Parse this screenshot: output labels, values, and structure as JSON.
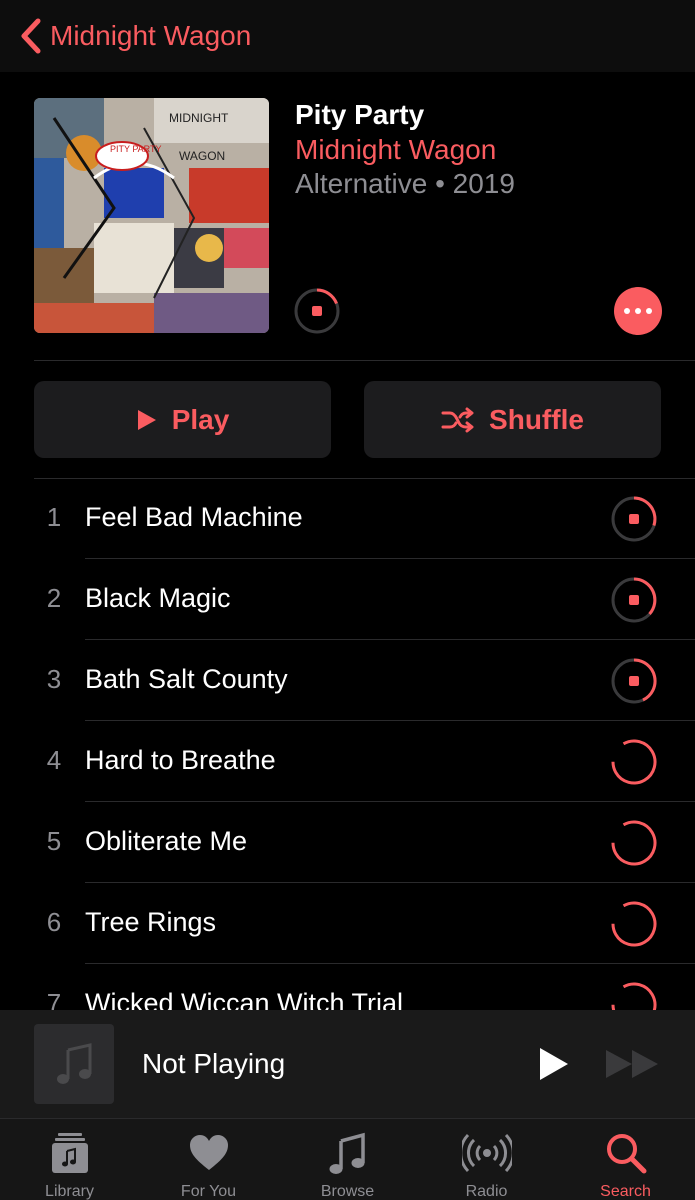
{
  "nav": {
    "back_label": "Midnight Wagon"
  },
  "album": {
    "title": "Pity Party",
    "artist": "Midnight Wagon",
    "meta": "Alternative • 2019",
    "art_texts": [
      "MIDNIGHT",
      "WAGON",
      "PITY PARTY"
    ]
  },
  "actions": {
    "play_label": "Play",
    "shuffle_label": "Shuffle"
  },
  "tracks": [
    {
      "num": "1",
      "title": "Feel Bad Machine",
      "download": "in-progress",
      "progress": 0.35
    },
    {
      "num": "2",
      "title": "Black Magic",
      "download": "in-progress",
      "progress": 0.4
    },
    {
      "num": "3",
      "title": "Bath Salt County",
      "download": "in-progress",
      "progress": 0.45
    },
    {
      "num": "4",
      "title": "Hard to Breathe",
      "download": "waiting"
    },
    {
      "num": "5",
      "title": "Obliterate Me",
      "download": "waiting"
    },
    {
      "num": "6",
      "title": "Tree Rings",
      "download": "waiting"
    },
    {
      "num": "7",
      "title": "Wicked Wiccan Witch Trial",
      "download": "waiting"
    }
  ],
  "mini_player": {
    "status": "Not Playing"
  },
  "tabs": [
    {
      "label": "Library",
      "icon": "library-icon",
      "active": false
    },
    {
      "label": "For You",
      "icon": "heart-icon",
      "active": false
    },
    {
      "label": "Browse",
      "icon": "music-note-icon",
      "active": false
    },
    {
      "label": "Radio",
      "icon": "radio-icon",
      "active": false
    },
    {
      "label": "Search",
      "icon": "search-icon",
      "active": true
    }
  ],
  "colors": {
    "accent": "#fa5c60",
    "background": "#000000",
    "secondary_text": "#8e8e93"
  }
}
